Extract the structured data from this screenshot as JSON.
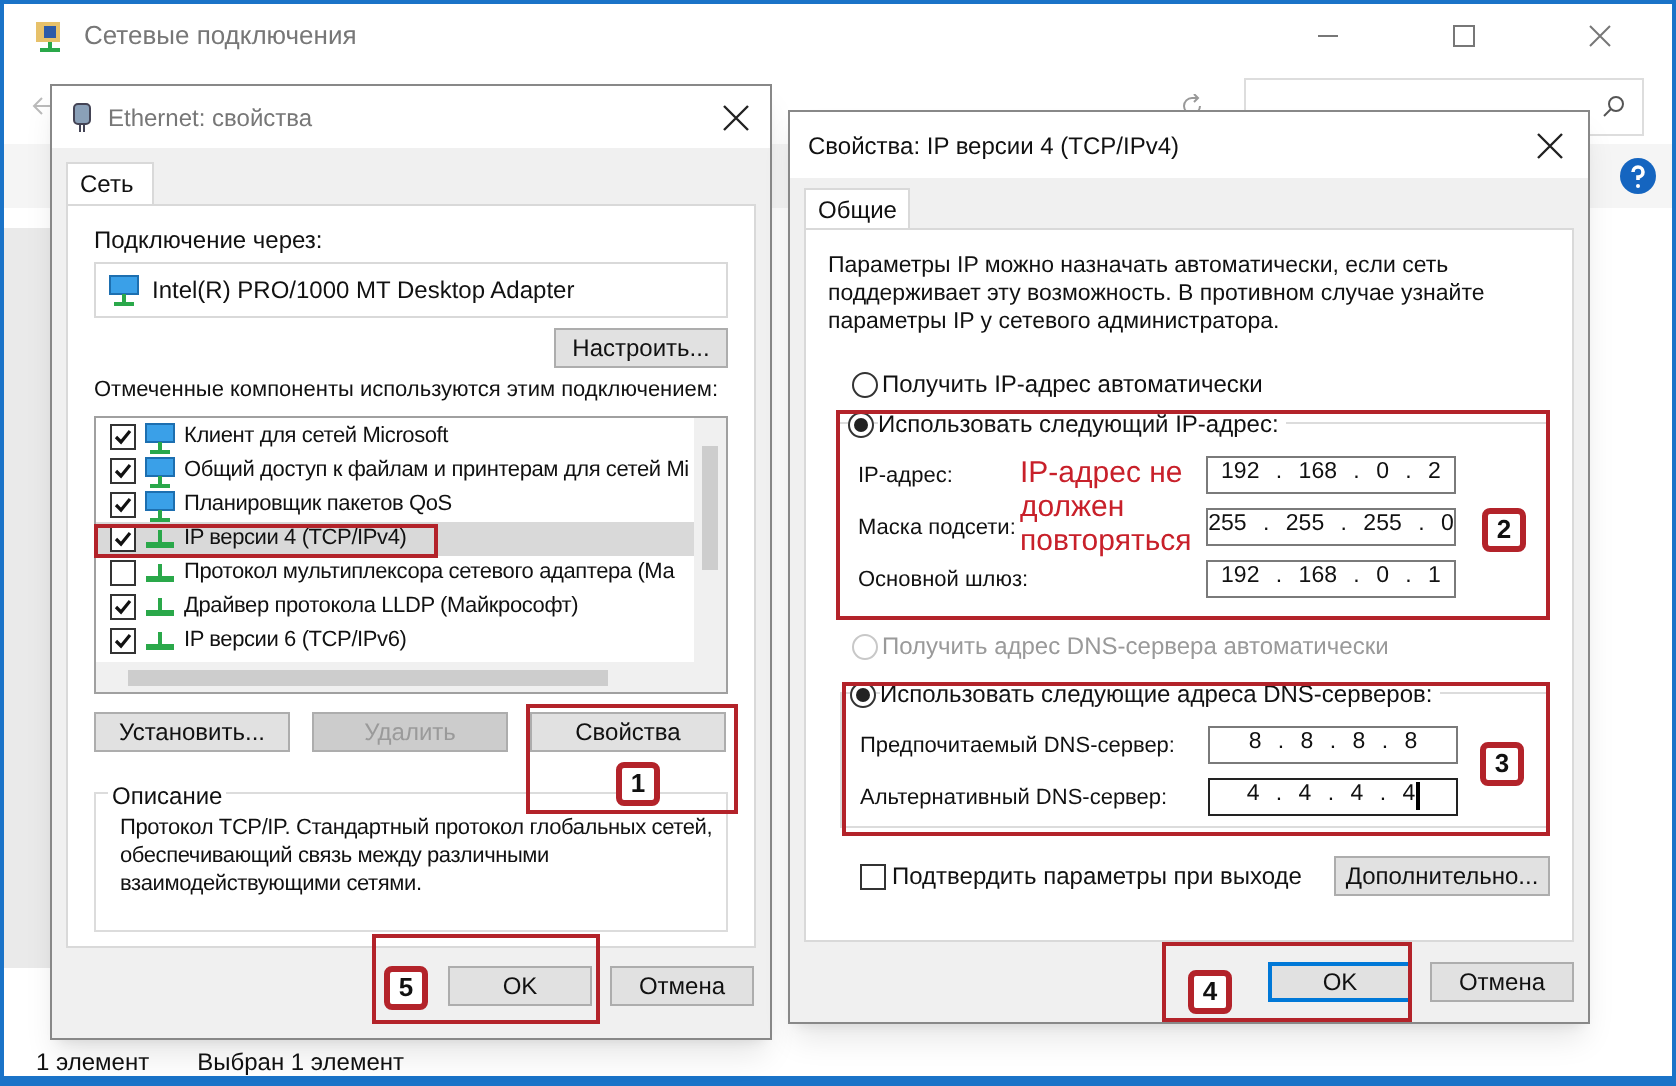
{
  "explorer": {
    "title": "Сетевые подключения",
    "status_bar": [
      "1 элемент",
      "Выбран 1 элемент"
    ]
  },
  "ethernet_dialog": {
    "title": "Ethernet: свойства",
    "tabs": [
      {
        "label": "Сеть",
        "selected": true
      }
    ],
    "connect_label": "Подключение через:",
    "adapter": "Intel(R) PRO/1000 MT Desktop Adapter",
    "configure_button": "Настроить...",
    "components_label": "Отмеченные компоненты используются этим подключением:",
    "components": [
      {
        "kind": "client",
        "label": "Клиент для сетей Microsoft",
        "checked": true,
        "selected": false
      },
      {
        "kind": "client",
        "label": "Общий доступ к файлам и принтерам для сетей Mi",
        "checked": true,
        "selected": false
      },
      {
        "kind": "client",
        "label": "Планировщик пакетов QoS",
        "checked": true,
        "selected": false
      },
      {
        "kind": "protocol",
        "label": "IP версии 4 (TCP/IPv4)",
        "checked": true,
        "selected": true
      },
      {
        "kind": "protocol",
        "label": "Протокол мультиплексора сетевого адаптера (Ма",
        "checked": false,
        "selected": false
      },
      {
        "kind": "protocol",
        "label": "Драйвер протокола LLDP (Майкрософт)",
        "checked": true,
        "selected": false
      },
      {
        "kind": "protocol",
        "label": "IP версии 6 (TCP/IPv6)",
        "checked": true,
        "selected": false
      }
    ],
    "buttons": [
      {
        "label": "Установить...",
        "disabled": false
      },
      {
        "label": "Удалить",
        "disabled": true
      },
      {
        "label": "Свойства",
        "disabled": false
      }
    ],
    "description": {
      "legend": "Описание",
      "text": "Протокол TCP/IP. Стандартный протокол глобальных сетей, обеспечивающий связь между различными взаимодействующими сетями."
    },
    "ok": {
      "label": "OK",
      "focused": false
    },
    "cancel": "Отмена"
  },
  "ipv4_dialog": {
    "title": "Свойства: IP версии 4 (TCP/IPv4)",
    "tabs": [
      {
        "label": "Общие",
        "selected": true
      }
    ],
    "intro": "Параметры IP можно назначать автоматически, если сеть поддерживает эту возможность. В противном случае узнайте параметры IP у сетевого администратора.",
    "ip_options": [
      {
        "label": "Получить IP-адрес автоматически",
        "selected": false,
        "disabled": false
      },
      {
        "label": "Использовать следующий IP-адрес:",
        "selected": true,
        "disabled": false
      }
    ],
    "ip_fields": [
      {
        "label": "IP-адрес:",
        "value": "192 . 168 . 0 . 2",
        "focused": false
      },
      {
        "label": "Маска подсети:",
        "value": "255 . 255 . 255 . 0",
        "focused": false
      },
      {
        "label": "Основной шлюз:",
        "value": "192 . 168 . 0 . 1",
        "focused": false
      }
    ],
    "dns_options": [
      {
        "label": "Получить адрес DNS-сервера автоматически",
        "selected": false,
        "disabled": true
      },
      {
        "label": "Использовать следующие адреса DNS-серверов:",
        "selected": true,
        "disabled": false
      }
    ],
    "dns_fields": [
      {
        "label": "Предпочитаемый DNS-сервер:",
        "value": "8 . 8 . 8 . 8",
        "focused": false
      },
      {
        "label": "Альтернативный DNS-сервер:",
        "value": "4 . 4 . 4 . 4",
        "focused": true
      }
    ],
    "validate": {
      "label": "Подтвердить параметры при выходе",
      "checked": false
    },
    "advanced_button": "Дополнительно...",
    "ok": {
      "label": "OK",
      "focused": true
    },
    "cancel": "Отмена"
  },
  "annotations": {
    "note": "IP-адрес не должен повторяться",
    "badges": [
      "1",
      "5",
      "2",
      "3",
      "4"
    ]
  }
}
